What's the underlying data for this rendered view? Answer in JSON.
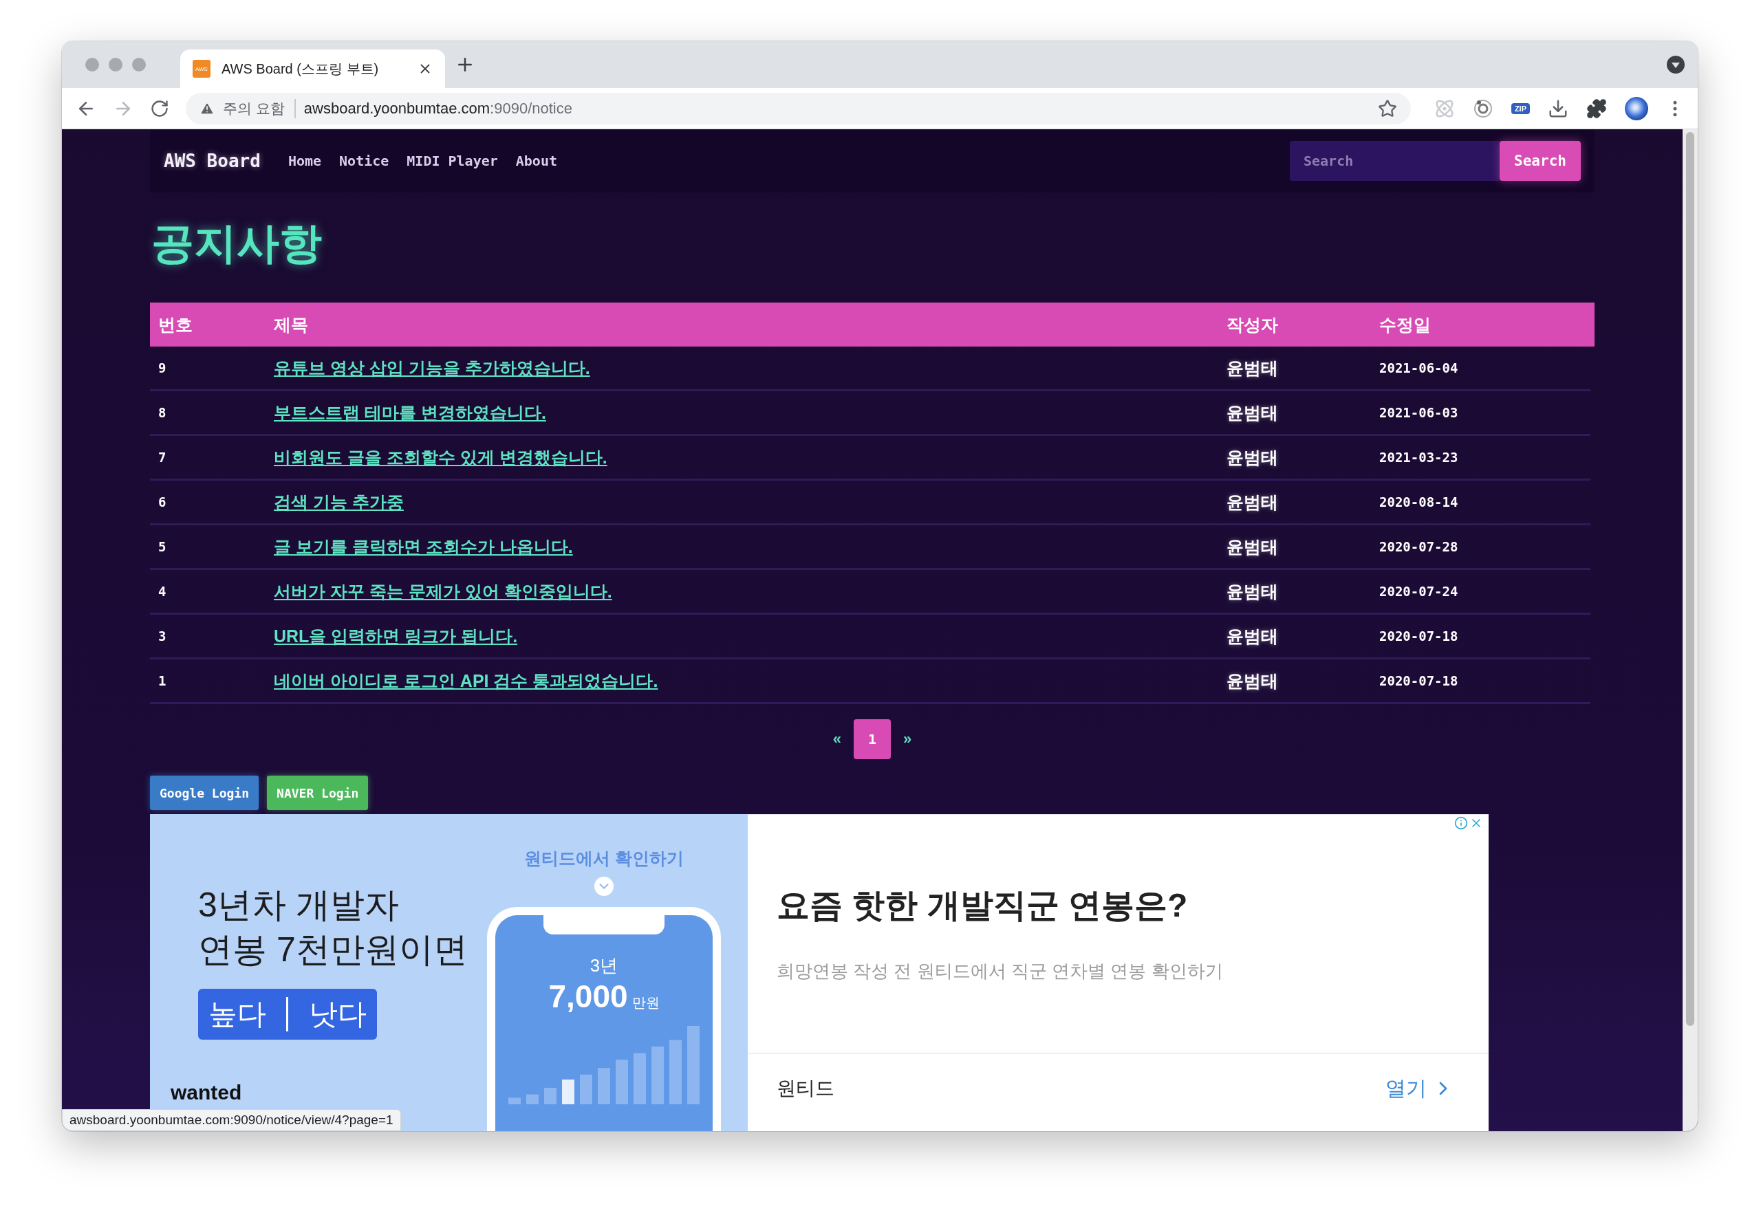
{
  "browser": {
    "tab": {
      "favicon": "AWS",
      "title": "AWS Board (스프링 부트)",
      "selected": true
    },
    "forward_disabled": true,
    "security_label": "주의 요함",
    "url_host": "awsboard.yoonbumtae.com",
    "url_path": ":9090/notice",
    "extensions": [
      {
        "kind": "atom"
      },
      {
        "kind": "target"
      },
      {
        "kind": "badge",
        "label": "ZIP"
      },
      {
        "kind": "download"
      },
      {
        "kind": "puzzle"
      },
      {
        "kind": "avatar"
      }
    ]
  },
  "navbar": {
    "brand": "AWS Board",
    "links": [
      "Home",
      "Notice",
      "MIDI Player",
      "About"
    ],
    "search": {
      "placeholder": "Search",
      "button": "Search"
    }
  },
  "page_title": "공지사항",
  "table": {
    "columns": [
      "번호",
      "제목",
      "작성자",
      "수정일"
    ],
    "rows": [
      {
        "number": "9",
        "title": "유튜브 영상 삽입 기능을 추가하였습니다.",
        "author": "윤범태",
        "date": "2021-06-04"
      },
      {
        "number": "8",
        "title": "부트스트랩 테마를 변경하였습니다.",
        "author": "윤범태",
        "date": "2021-06-03"
      },
      {
        "number": "7",
        "title": "비회원도 글을 조회할수 있게 변경했습니다.",
        "author": "윤범태",
        "date": "2021-03-23"
      },
      {
        "number": "6",
        "title": "검색 기능 추가중",
        "author": "윤범태",
        "date": "2020-08-14"
      },
      {
        "number": "5",
        "title": "글 보기를 클릭하면 조회수가 나옵니다.",
        "author": "윤범태",
        "date": "2020-07-28"
      },
      {
        "number": "4",
        "title": "서버가 자꾸 죽는 문제가 있어 확인중입니다.",
        "author": "윤범태",
        "date": "2020-07-24"
      },
      {
        "number": "3",
        "title": "URL을 입력하면 링크가 됩니다.",
        "author": "윤범태",
        "date": "2020-07-18"
      },
      {
        "number": "1",
        "title": "네이버 아이디로 로그인 API 검수 통과되었습니다.",
        "author": "윤범태",
        "date": "2020-07-18"
      }
    ]
  },
  "pagination": {
    "prev": "«",
    "pages": [
      {
        "label": "1",
        "selected": true
      }
    ],
    "next": "»"
  },
  "login_buttons": [
    {
      "kind": "google",
      "label": "Google Login"
    },
    {
      "kind": "naver",
      "label": "NAVER Login"
    }
  ],
  "ad": {
    "banner": {
      "headline_lines": [
        "3년차 개발자",
        "연봉 7천만원이면"
      ],
      "choices": [
        "높다",
        "낫다"
      ],
      "brand": "wanted",
      "cta": "원티드에서 확인하기",
      "phone_year": "3년",
      "phone_amount": "7,000",
      "phone_unit": "만원"
    },
    "title": "요즘 핫한 개발직군 연봉은?",
    "description": "희망연봉 작성 전 원티드에서 직군 연차별 연봉 확인하기",
    "advertiser": "원티드",
    "open_label": "열기"
  },
  "status_bar": "awsboard.yoonbumtae.com:9090/notice/view/4?page=1"
}
